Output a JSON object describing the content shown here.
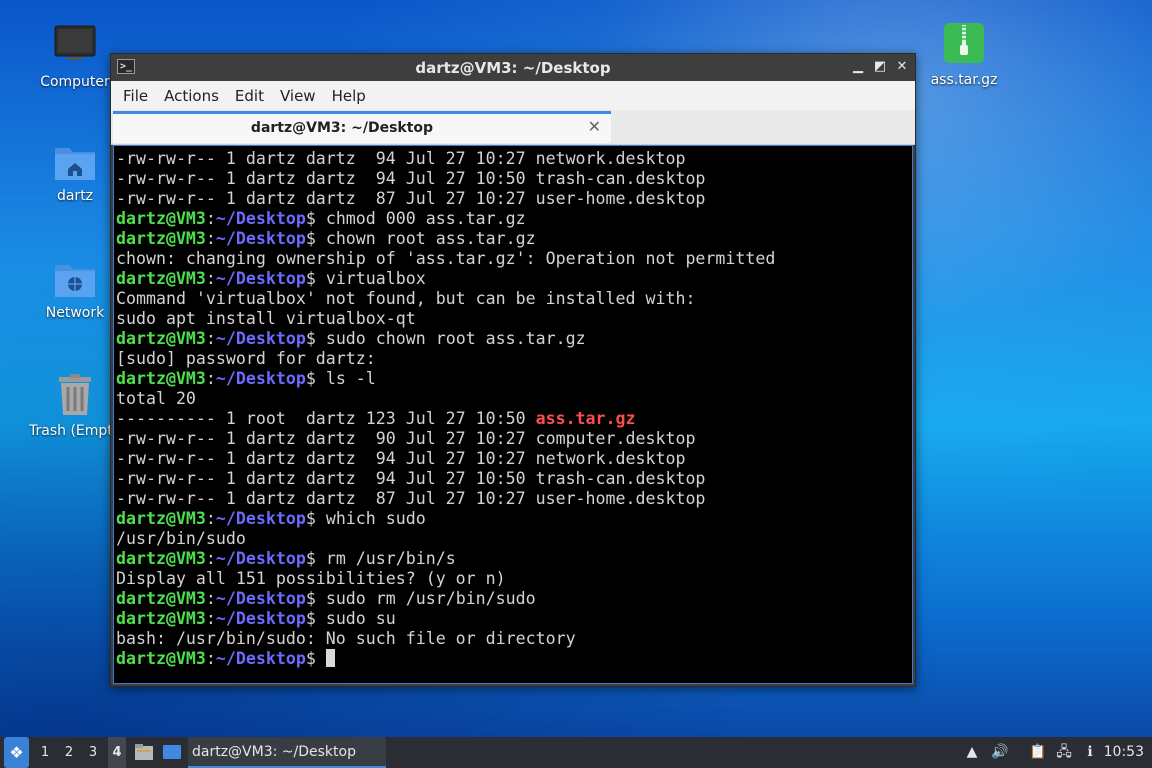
{
  "desktop": {
    "icons": [
      {
        "label": "Computer"
      },
      {
        "label": "dartz"
      },
      {
        "label": "Network"
      },
      {
        "label": "Trash (Empty)"
      },
      {
        "label": "ass.tar.gz"
      }
    ]
  },
  "window": {
    "title": "dartz@VM3: ~/Desktop",
    "menu": [
      "File",
      "Actions",
      "Edit",
      "View",
      "Help"
    ],
    "tab_label": "dartz@VM3: ~/Desktop",
    "controls": {
      "minimize": "▁",
      "maximize": "◩",
      "close": "✕"
    }
  },
  "terminal": {
    "prompt_user": "dartz@VM3",
    "prompt_path": "~/Desktop",
    "lines": [
      {
        "type": "out",
        "text": "-rw-rw-r-- 1 dartz dartz  94 Jul 27 10:27 network.desktop"
      },
      {
        "type": "out",
        "text": "-rw-rw-r-- 1 dartz dartz  94 Jul 27 10:50 trash-can.desktop"
      },
      {
        "type": "out",
        "text": "-rw-rw-r-- 1 dartz dartz  87 Jul 27 10:27 user-home.desktop"
      },
      {
        "type": "cmd",
        "text": "chmod 000 ass.tar.gz"
      },
      {
        "type": "cmd",
        "text": "chown root ass.tar.gz"
      },
      {
        "type": "out",
        "text": "chown: changing ownership of 'ass.tar.gz': Operation not permitted"
      },
      {
        "type": "cmd",
        "text": "virtualbox"
      },
      {
        "type": "out",
        "text": "Command 'virtualbox' not found, but can be installed with:"
      },
      {
        "type": "out",
        "text": "sudo apt install virtualbox-qt"
      },
      {
        "type": "cmd",
        "text": "sudo chown root ass.tar.gz"
      },
      {
        "type": "out",
        "text": "[sudo] password for dartz:"
      },
      {
        "type": "cmd",
        "text": "ls -l"
      },
      {
        "type": "out",
        "text": "total 20"
      },
      {
        "type": "hl",
        "text": "---------- 1 root  dartz 123 Jul 27 10:50 ",
        "hl": "ass.tar.gz"
      },
      {
        "type": "out",
        "text": "-rw-rw-r-- 1 dartz dartz  90 Jul 27 10:27 computer.desktop"
      },
      {
        "type": "out",
        "text": "-rw-rw-r-- 1 dartz dartz  94 Jul 27 10:27 network.desktop"
      },
      {
        "type": "out",
        "text": "-rw-rw-r-- 1 dartz dartz  94 Jul 27 10:50 trash-can.desktop"
      },
      {
        "type": "out",
        "text": "-rw-rw-r-- 1 dartz dartz  87 Jul 27 10:27 user-home.desktop"
      },
      {
        "type": "cmd",
        "text": "which sudo"
      },
      {
        "type": "out",
        "text": "/usr/bin/sudo"
      },
      {
        "type": "cmd",
        "text": "rm /usr/bin/s"
      },
      {
        "type": "out",
        "text": "Display all 151 possibilities? (y or n)"
      },
      {
        "type": "cmd",
        "text": "sudo rm /usr/bin/sudo"
      },
      {
        "type": "cmd",
        "text": "sudo su"
      },
      {
        "type": "out",
        "text": "bash: /usr/bin/sudo: No such file or directory"
      },
      {
        "type": "cursor",
        "text": ""
      }
    ]
  },
  "taskbar": {
    "workspaces": [
      "1",
      "2",
      "3",
      "4"
    ],
    "active_workspace": "4",
    "task_label": "dartz@VM3: ~/Desktop",
    "clock": "10:53"
  },
  "colors": {
    "prompt_user": "#4edf4e",
    "prompt_path": "#6b6bff",
    "highlight_file": "#ff4d4d",
    "accent": "#3f8ae0"
  }
}
